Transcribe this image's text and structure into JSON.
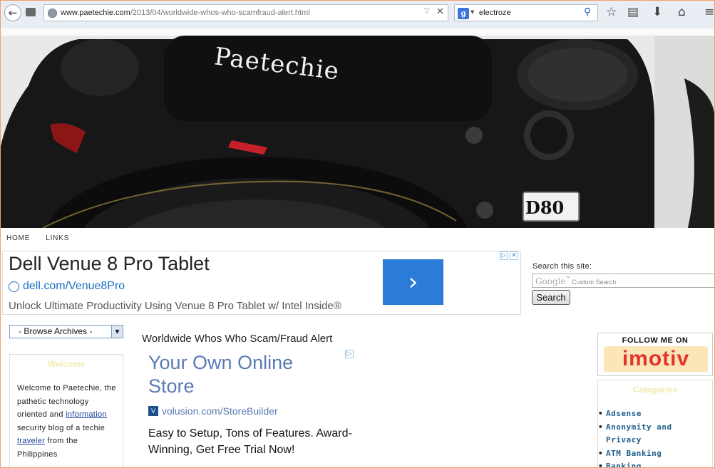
{
  "browser": {
    "url_domain": "www.paetechie.com",
    "url_path": "/2013/04/worldwide-whos-who-scamfraud-alert.html",
    "search_engine_letter": "g",
    "search_query": "electroze"
  },
  "site": {
    "title": "Paetechie",
    "camera_label": "D80",
    "nav": [
      "HOME",
      "LINKS"
    ]
  },
  "top_ad": {
    "title": "Dell Venue 8 Pro Tablet",
    "site": "dell.com/Venue8Pro",
    "description": "Unlock Ultimate Productivity Using Venue 8 Pro Tablet w/ Intel Inside®",
    "brand_icon": "dell-logo"
  },
  "site_search": {
    "label": "Search this site:",
    "google_word": "Google",
    "placeholder": "Custom Search",
    "button": "Search"
  },
  "sidebar_left": {
    "archives_label": "- Browse Archives -",
    "welcome_title": "Welcome",
    "welcome_text_1": "Welcome to Paetechie, the pathetic technology oriented and ",
    "welcome_link_1": "information",
    "welcome_text_2": " security blog of a techie ",
    "welcome_link_2": "traveler",
    "welcome_text_3": " from the Philippines"
  },
  "post": {
    "title": "Worldwide Whos Who Scam/Fraud Alert",
    "ad_title": "Your Own Online Store",
    "ad_site": "volusion.com/StoreBuilder",
    "ad_desc": "Easy to Setup, Tons of Features. Award-Winning, Get Free Trial Now!"
  },
  "sidebar_right": {
    "follow_text": "FOLLOW ME ON",
    "imotiv": "imotiv",
    "categories_title": "Categories",
    "categories": [
      "Adsense",
      "Anonymity and Privacy",
      "ATM Banking",
      "Banking"
    ]
  },
  "colors": {
    "accent_link": "#1a3e9c",
    "ad_blue": "#2a7cd6",
    "category_blue": "#1f5f8c",
    "window_border": "#f2a06a"
  }
}
